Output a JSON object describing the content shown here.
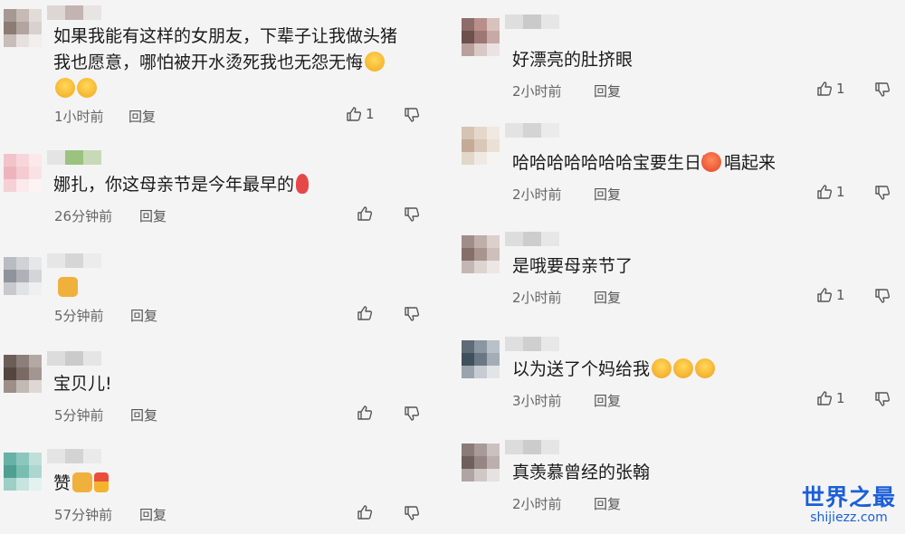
{
  "comments": [
    {
      "id": "c1",
      "lines": [
        "如果我能有这样的女朋友，下辈子让我做头猪",
        "我也愿意，哪怕被开水烫死我也无怨无悔"
      ],
      "time": "1小时前",
      "reply": "回复",
      "likes": "1",
      "avatar": [
        "#a69994",
        "#c7b9b4",
        "#e2dcd9",
        "#8d7b76",
        "#b3a49f",
        "#d9d1ce",
        "#c9bdb9",
        "#e6e1df",
        "#f1eeed"
      ],
      "name": [
        "#ddd6d4",
        "#c3b4b1",
        "#e8e4e3"
      ]
    },
    {
      "id": "c2",
      "lines": [
        "娜扎，你这母亲节是今年最早的"
      ],
      "time": "26分钟前",
      "reply": "回复",
      "likes": "",
      "avatar": [
        "#f3c3cb",
        "#f7d6db",
        "#fbe8eb",
        "#eeb4bd",
        "#f4cbd1",
        "#f9e2e5",
        "#f5d0d5",
        "#faeaec",
        "#fdf3f4"
      ],
      "name": [
        "#e4e4e4",
        "#9bc27f",
        "#c8d9b7"
      ]
    },
    {
      "id": "c3",
      "lines": [
        "👍"
      ],
      "time": "5分钟前",
      "reply": "回复",
      "likes": "",
      "avatar": [
        "#b9bcc2",
        "#d0d2d6",
        "#e6e7e9",
        "#8f939b",
        "#aeb1b7",
        "#d3d5d8",
        "#c7c9cd",
        "#e1e2e4",
        "#eeeff0"
      ],
      "name": [
        "#e6e6e6",
        "#d6d6d6",
        "#ececec"
      ]
    },
    {
      "id": "c4",
      "lines": [
        "宝贝儿!"
      ],
      "time": "5分钟前",
      "reply": "回复",
      "likes": "",
      "avatar": [
        "#6d5d58",
        "#8d7e79",
        "#b3a8a4",
        "#54453f",
        "#7a6a64",
        "#a39590",
        "#9c8f8a",
        "#c2b8b4",
        "#ddd7d5"
      ],
      "name": [
        "#dcdcdc",
        "#cbcbcb",
        "#e5e5e5"
      ]
    },
    {
      "id": "c5",
      "lines": [
        "赞"
      ],
      "time": "57分钟前",
      "reply": "回复",
      "likes": "",
      "avatar": [
        "#66b2a6",
        "#8cc7bd",
        "#bfdfd9",
        "#4f9f93",
        "#79bdb1",
        "#acd6cf",
        "#9dcfc6",
        "#c7e4df",
        "#e3f1ef"
      ],
      "name": [
        "#e4e4e4",
        "#d3d3d3",
        "#eaeaea"
      ]
    },
    {
      "id": "c6",
      "lines": [
        "好漂亮的肚挤眼"
      ],
      "time": "2小时前",
      "reply": "回复",
      "likes": "1",
      "avatar": [
        "#8e6c69",
        "#b88f8b",
        "#d9c1be",
        "#6e504d",
        "#9d7773",
        "#c7a9a6",
        "#b8a09d",
        "#d8c8c6",
        "#ebe3e2"
      ],
      "name": [
        "#dedede",
        "#cacaca",
        "#e6e6e6"
      ]
    },
    {
      "id": "c7",
      "lines": [
        "哈哈哈哈哈哈哈宝要生日了 唱起来"
      ],
      "time": "2小时前",
      "reply": "回复",
      "likes": "1",
      "avatar": [
        "#d6c3b3",
        "#e5d7cb",
        "#f0e8e1",
        "#c3ab97",
        "#d9c7b7",
        "#ebe0d6",
        "#e3d6ca",
        "#f0e9e3",
        "#f7f3f0"
      ],
      "name": [
        "#e3e3e3",
        "#d4d4d4",
        "#ebebeb"
      ]
    },
    {
      "id": "c8",
      "lines": [
        "是哦要母亲节了"
      ],
      "time": "2小时前",
      "reply": "回复",
      "likes": "1",
      "avatar": [
        "#a18d87",
        "#bfaea9",
        "#dbd0cc",
        "#857069",
        "#a8958f",
        "#cdbfba",
        "#c4b7b3",
        "#ddd3d0",
        "#ece6e4"
      ],
      "name": [
        "#dddddd",
        "#cdcdcd",
        "#e7e7e7"
      ]
    },
    {
      "id": "c9",
      "lines": [
        "以为送了个妈给我"
      ],
      "time": "3小时前",
      "reply": "回复",
      "likes": "1",
      "avatar": [
        "#5f6c78",
        "#8a96a1",
        "#b9c1c8",
        "#41505d",
        "#6b7884",
        "#a4adb6",
        "#9aa4ad",
        "#c6ccd2",
        "#e1e5e8"
      ],
      "name": [
        "#dfdfdf",
        "#cfcfcf",
        "#e8e8e8"
      ]
    },
    {
      "id": "c10",
      "lines": [
        "真羡慕曾经的张翰"
      ],
      "time": "2小时前",
      "reply": "回复",
      "likes": "",
      "avatar": [
        "#8a7a78",
        "#a89a98",
        "#cbc2c0",
        "#6f5f5d",
        "#958583",
        "#bbb0ae",
        "#b0a5a3",
        "#d0c8c7",
        "#e6e2e1"
      ],
      "name": [
        "#dcdcdc",
        "#cccccc",
        "#e5e5e5"
      ]
    }
  ],
  "watermark": {
    "title": "世界之最",
    "url": "shijiezz.com"
  },
  "colors": {
    "meta": "#666666",
    "brand": "#1c5fd6"
  }
}
